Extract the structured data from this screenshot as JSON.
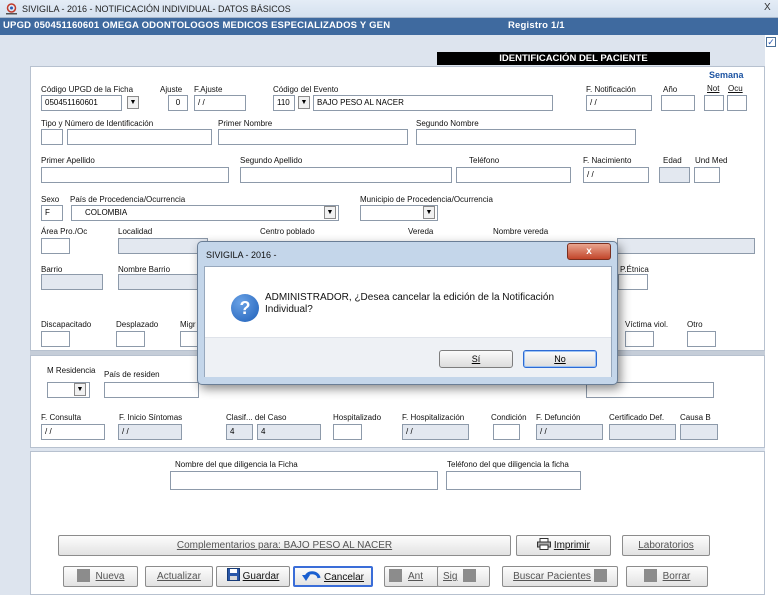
{
  "window": {
    "title": "SIVIGILA - 2016 -  NOTIFICACIÓN INDIVIDUAL- DATOS BÁSICOS",
    "close": "X"
  },
  "header": {
    "upgd": "UPGD 050451160601 OMEGA ODONTOLOGOS MEDICOS ESPECIALIZADOS Y GEN",
    "registro": "Registro 1/1",
    "section": "IDENTIFICACIÓN DEL PACIENTE"
  },
  "fields": {
    "codigo_upgd_label": "Código UPGD de la Ficha",
    "codigo_upgd": "050451160601",
    "ajuste_label": "Ajuste",
    "ajuste": "0",
    "f_ajuste_label": "F.Ajuste",
    "f_ajuste": "/ /",
    "codigo_evento_label": "Código del Evento",
    "codigo_evento": "110",
    "evento_nombre": "BAJO PESO AL NACER",
    "f_notificacion_label": "F. Notificación",
    "f_notificacion": "/ /",
    "anio_label": "Año",
    "semana_label": "Semana",
    "not_label": "Not",
    "ocu_label": "Ocu",
    "tipo_id_label": "Tipo y Número de Identificación",
    "primer_nombre_label": "Primer Nombre",
    "segundo_nombre_label": "Segundo Nombre",
    "primer_apellido_label": "Primer Apellido",
    "segundo_apellido_label": "Segundo Apellido",
    "telefono_label": "Teléfono",
    "f_nacimiento_label": "F. Nacimiento",
    "f_nacimiento": "/ /",
    "edad_label": "Edad",
    "und_med_label": "Und Med",
    "sexo_label": "Sexo",
    "sexo": "F",
    "pais_label": "País de Procedencia/Ocurrencia",
    "pais": "COLOMBIA",
    "municipio_label": "Municipio de Procedencia/Ocurrencia",
    "area_label": "Área Pro./Oc",
    "localidad_label": "Localidad",
    "centro_poblado_label": "Centro poblado",
    "vereda_label": "Vereda",
    "nombre_vereda_label": "Nombre vereda",
    "barrio_label": "Barrio",
    "nombre_barrio_label": "Nombre Barrio",
    "p_etnica_label": "P.Étnica",
    "discapacitado_label": "Discapacitado",
    "desplazado_label": "Desplazado",
    "migrante_label": "Migr",
    "victima_label": "Víctima viol.",
    "otro_label": "Otro",
    "m_residencia_label": "M Residencia",
    "pais_residencia_label": "País de residen",
    "f_consulta_label": "F. Consulta",
    "f_consulta": "/ /",
    "f_inicio_label": "F. Inicio Síntomas",
    "f_inicio": "/ /",
    "clasif_label": "Clasif... del Caso",
    "clasif1": "4",
    "clasif2": "4",
    "hospitalizado_label": "Hospitalizado",
    "f_hosp_label": "F. Hospitalización",
    "f_hosp": "/ /",
    "condicion_label": "Condición",
    "f_defuncion_label": "F. Defunción",
    "f_defuncion": "/ /",
    "certificado_label": "Certificado Def.",
    "causa_label": "Causa B",
    "diligencia_nombre_label": "Nombre del que diligencia la Ficha",
    "diligencia_tel_label": "Teléfono del que diligencia la ficha"
  },
  "buttons": {
    "complementarios": "Complementarios para: BAJO PESO AL NACER",
    "imprimir": "Imprimir",
    "laboratorios": "Laboratorios",
    "nueva": "Nueva",
    "actualizar": "Actualizar",
    "guardar": "Guardar",
    "cancelar": "Cancelar",
    "ant": "Ant",
    "sig": "Sig",
    "buscar": "Buscar Pacientes",
    "borrar": "Borrar"
  },
  "dialog": {
    "title": "SIVIGILA - 2016 -",
    "close": "x",
    "message": "ADMINISTRADOR, ¿Desea cancelar la edición de la Notificación Individual?",
    "yes": "Sí",
    "no": "No"
  }
}
